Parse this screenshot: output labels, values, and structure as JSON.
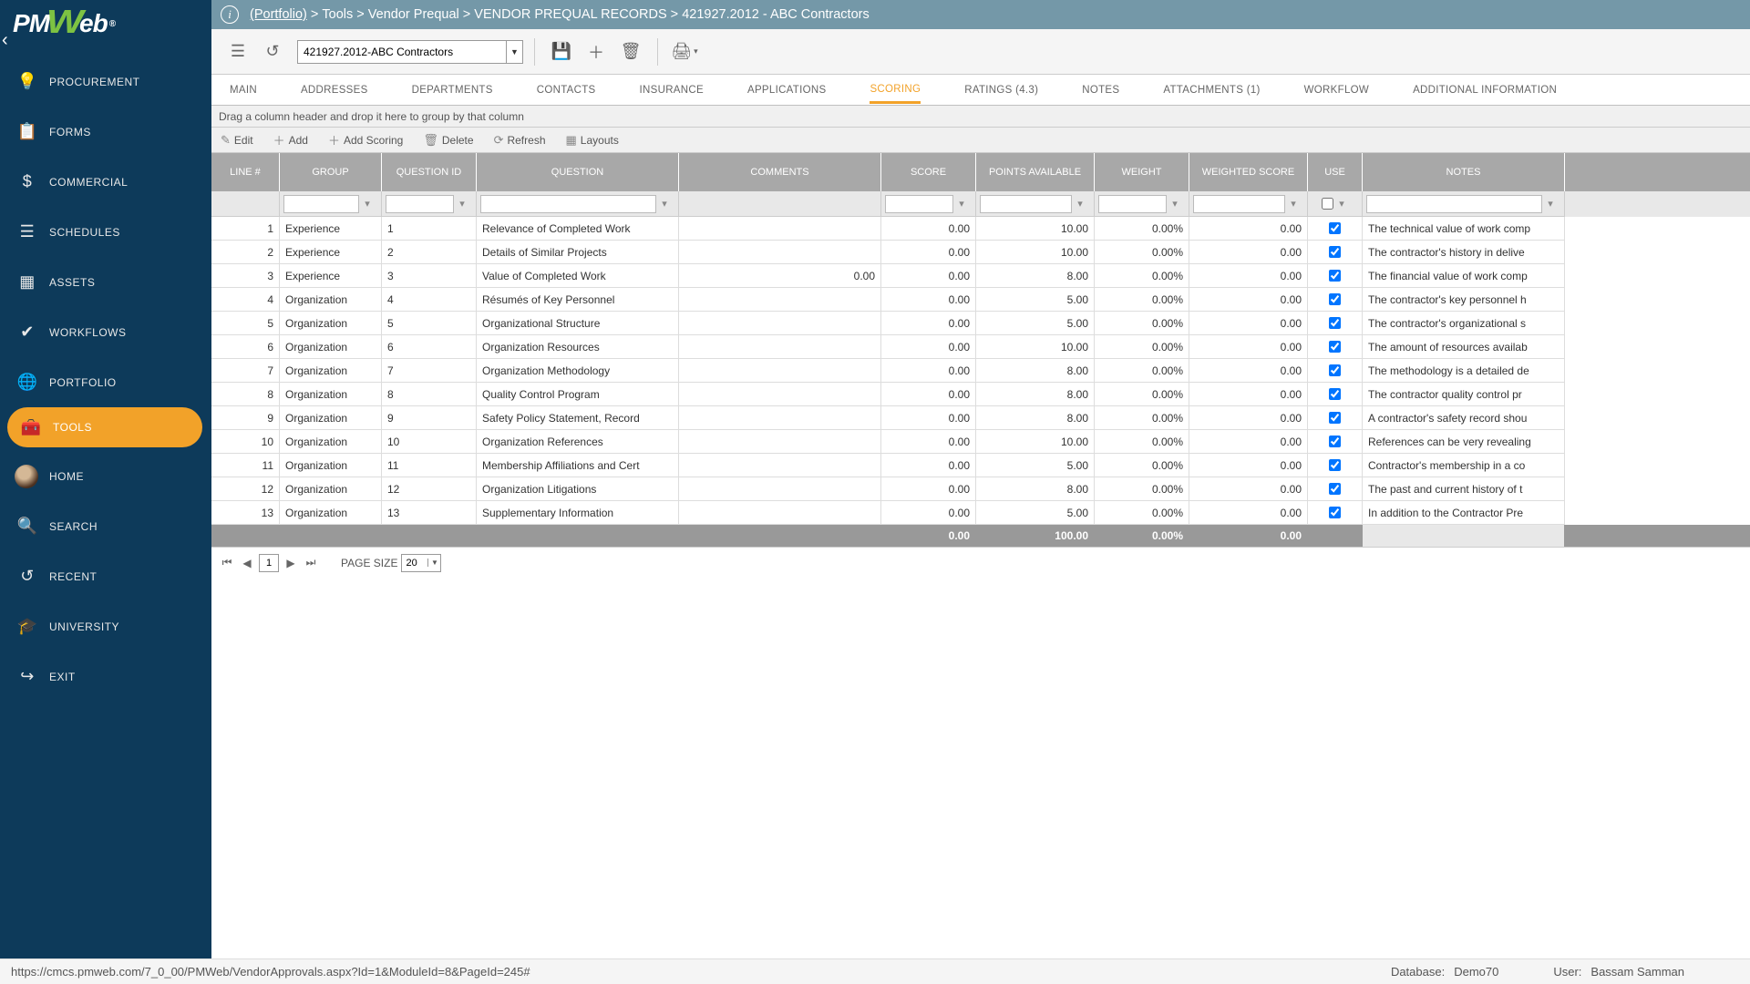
{
  "logo": {
    "text": "PMWeb"
  },
  "breadcrumb": {
    "portfolio": "(Portfolio)",
    "sep1": " > ",
    "p1": "Tools",
    "p2": "Vendor Prequal",
    "p3": "VENDOR PREQUAL RECORDS",
    "p4": "421927.2012 - ABC Contractors"
  },
  "record_selector": "421927.2012-ABC Contractors",
  "sidebar": {
    "items": [
      {
        "icon": "💡",
        "label": "PROCUREMENT"
      },
      {
        "icon": "📋",
        "label": "FORMS"
      },
      {
        "icon": "$",
        "label": "COMMERCIAL"
      },
      {
        "icon": "☰",
        "label": "SCHEDULES"
      },
      {
        "icon": "▦",
        "label": "ASSETS"
      },
      {
        "icon": "✔",
        "label": "WORKFLOWS"
      },
      {
        "icon": "🌐",
        "label": "PORTFOLIO"
      },
      {
        "icon": "🧰",
        "label": "TOOLS"
      }
    ],
    "items2": [
      {
        "label": "HOME"
      },
      {
        "icon": "🔍",
        "label": "SEARCH"
      },
      {
        "icon": "↺",
        "label": "RECENT"
      },
      {
        "icon": "🎓",
        "label": "UNIVERSITY"
      },
      {
        "icon": "↪",
        "label": "EXIT"
      }
    ]
  },
  "tabs": [
    {
      "label": "MAIN"
    },
    {
      "label": "ADDRESSES"
    },
    {
      "label": "DEPARTMENTS"
    },
    {
      "label": "CONTACTS"
    },
    {
      "label": "INSURANCE"
    },
    {
      "label": "APPLICATIONS"
    },
    {
      "label": "SCORING"
    },
    {
      "label": "RATINGS (4.3)"
    },
    {
      "label": "NOTES"
    },
    {
      "label": "ATTACHMENTS (1)"
    },
    {
      "label": "WORKFLOW"
    },
    {
      "label": "ADDITIONAL INFORMATION"
    }
  ],
  "group_hint": "Drag a column header and drop it here to group by that column",
  "grid_toolbar": {
    "edit": "Edit",
    "add": "Add",
    "add_scoring": "Add Scoring",
    "delete": "Delete",
    "refresh": "Refresh",
    "layouts": "Layouts"
  },
  "columns": {
    "line": "LINE #",
    "group": "GROUP",
    "qid": "QUESTION ID",
    "question": "QUESTION",
    "comments": "COMMENTS",
    "score": "SCORE",
    "points": "POINTS AVAILABLE",
    "weight": "WEIGHT",
    "wscore": "WEIGHTED SCORE",
    "use": "USE",
    "notes": "NOTES"
  },
  "rows": [
    {
      "line": "1",
      "group": "Experience",
      "qid": "1",
      "question": "Relevance of Completed Work",
      "comments": "",
      "score": "0.00",
      "points": "10.00",
      "weight": "0.00%",
      "wscore": "0.00",
      "use": true,
      "notes": "The technical value of work comp"
    },
    {
      "line": "2",
      "group": "Experience",
      "qid": "2",
      "question": "Details of Similar Projects",
      "comments": "",
      "score": "0.00",
      "points": "10.00",
      "weight": "0.00%",
      "wscore": "0.00",
      "use": true,
      "notes": "The contractor's history in delive"
    },
    {
      "line": "3",
      "group": "Experience",
      "qid": "3",
      "question": "Value of Completed Work",
      "comments": "0.00",
      "score": "0.00",
      "points": "8.00",
      "weight": "0.00%",
      "wscore": "0.00",
      "use": true,
      "notes": "The financial value of work comp"
    },
    {
      "line": "4",
      "group": "Organization",
      "qid": "4",
      "question": "Résumés of Key Personnel",
      "comments": "",
      "score": "0.00",
      "points": "5.00",
      "weight": "0.00%",
      "wscore": "0.00",
      "use": true,
      "notes": "The contractor's key personnel h"
    },
    {
      "line": "5",
      "group": "Organization",
      "qid": "5",
      "question": "Organizational Structure",
      "comments": "",
      "score": "0.00",
      "points": "5.00",
      "weight": "0.00%",
      "wscore": "0.00",
      "use": true,
      "notes": "The contractor's organizational s"
    },
    {
      "line": "6",
      "group": "Organization",
      "qid": "6",
      "question": "Organization Resources",
      "comments": "",
      "score": "0.00",
      "points": "10.00",
      "weight": "0.00%",
      "wscore": "0.00",
      "use": true,
      "notes": "The amount of resources availab"
    },
    {
      "line": "7",
      "group": "Organization",
      "qid": "7",
      "question": "Organization Methodology",
      "comments": "",
      "score": "0.00",
      "points": "8.00",
      "weight": "0.00%",
      "wscore": "0.00",
      "use": true,
      "notes": "The methodology is a detailed de"
    },
    {
      "line": "8",
      "group": "Organization",
      "qid": "8",
      "question": "Quality Control Program",
      "comments": "",
      "score": "0.00",
      "points": "8.00",
      "weight": "0.00%",
      "wscore": "0.00",
      "use": true,
      "notes": "The contractor quality control pr"
    },
    {
      "line": "9",
      "group": "Organization",
      "qid": "9",
      "question": "Safety Policy Statement, Record",
      "comments": "",
      "score": "0.00",
      "points": "8.00",
      "weight": "0.00%",
      "wscore": "0.00",
      "use": true,
      "notes": "A contractor's safety record shou"
    },
    {
      "line": "10",
      "group": "Organization",
      "qid": "10",
      "question": "Organization References",
      "comments": "",
      "score": "0.00",
      "points": "10.00",
      "weight": "0.00%",
      "wscore": "0.00",
      "use": true,
      "notes": "References can be very revealing"
    },
    {
      "line": "11",
      "group": "Organization",
      "qid": "11",
      "question": "Membership Affiliations and Cert",
      "comments": "",
      "score": "0.00",
      "points": "5.00",
      "weight": "0.00%",
      "wscore": "0.00",
      "use": true,
      "notes": "Contractor's membership in a co"
    },
    {
      "line": "12",
      "group": "Organization",
      "qid": "12",
      "question": "Organization Litigations",
      "comments": "",
      "score": "0.00",
      "points": "8.00",
      "weight": "0.00%",
      "wscore": "0.00",
      "use": true,
      "notes": "The past and current history of t"
    },
    {
      "line": "13",
      "group": "Organization",
      "qid": "13",
      "question": "Supplementary Information",
      "comments": "",
      "score": "0.00",
      "points": "5.00",
      "weight": "0.00%",
      "wscore": "0.00",
      "use": true,
      "notes": "In addition to the Contractor Pre"
    }
  ],
  "totals": {
    "score": "0.00",
    "points": "100.00",
    "weight": "0.00%",
    "wscore": "0.00"
  },
  "pager": {
    "page": "1",
    "page_size_label": "PAGE SIZE",
    "page_size": "20"
  },
  "status": {
    "url": "https://cmcs.pmweb.com/7_0_00/PMWeb/VendorApprovals.aspx?Id=1&ModuleId=8&PageId=245#",
    "db_label": "Database:",
    "db": "Demo70",
    "user_label": "User:",
    "user": "Bassam Samman"
  }
}
